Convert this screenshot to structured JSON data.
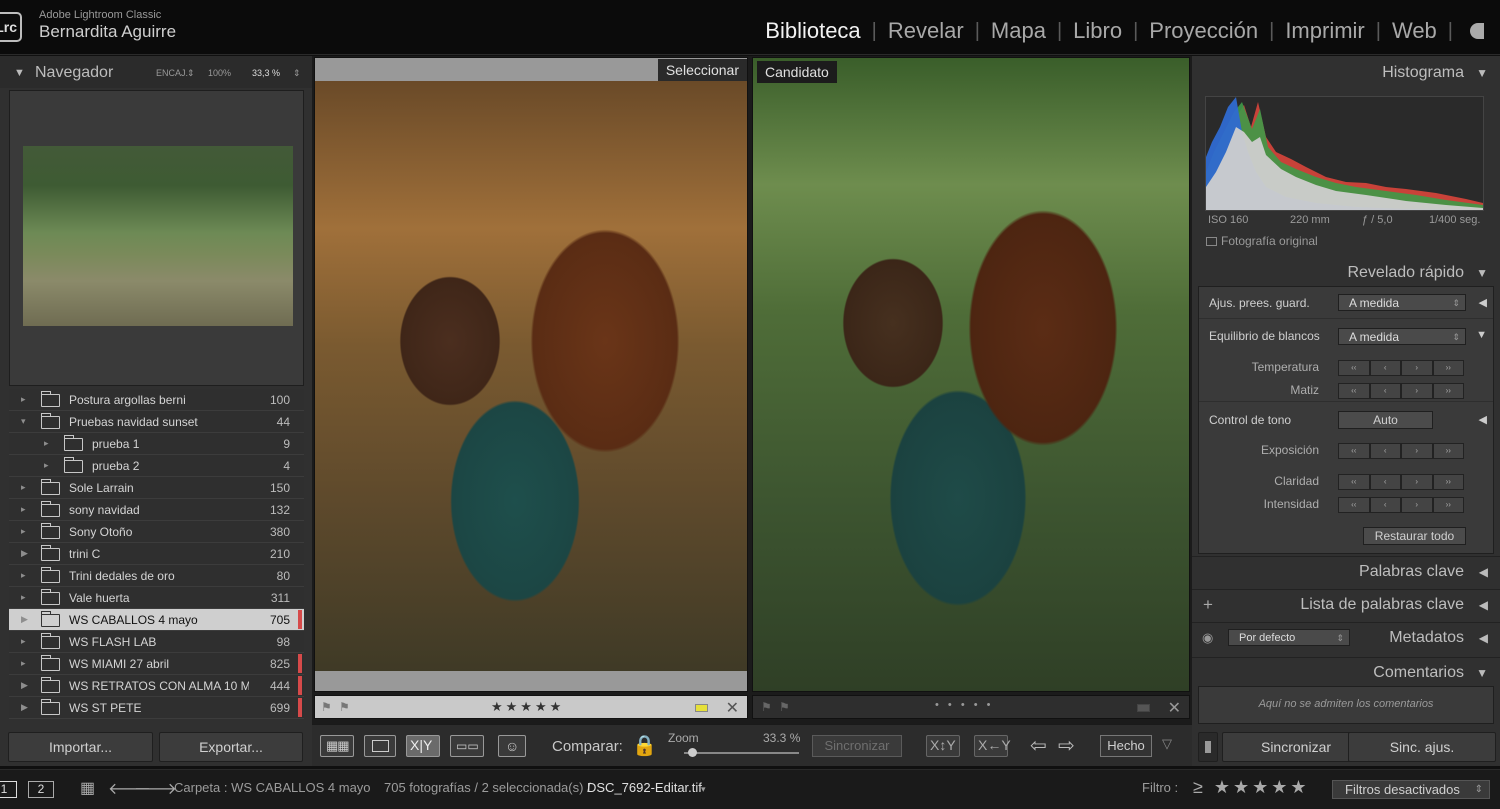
{
  "app": {
    "logo": "Lrc",
    "name": "Adobe Lightroom Classic",
    "user": "Bernardita Aguirre"
  },
  "modules": [
    "Biblioteca",
    "Revelar",
    "Mapa",
    "Libro",
    "Proyección",
    "Imprimir",
    "Web"
  ],
  "active_module": "Biblioteca",
  "navigator": {
    "title": "Navegador",
    "fit": "ENCAJ.",
    "fit_arrows": "⇕",
    "z100": "100%",
    "z33": "33,3 %",
    "z_arrows": "⇕"
  },
  "folders": [
    {
      "name": "Postura argollas berni",
      "count": "100",
      "indent": 0,
      "expand": "▸",
      "mark": false,
      "selected": false
    },
    {
      "name": "Pruebas navidad sunset",
      "count": "44",
      "indent": 0,
      "expand": "▾",
      "mark": false,
      "selected": false
    },
    {
      "name": "prueba 1",
      "count": "9",
      "indent": 1,
      "expand": "▸",
      "mark": false,
      "selected": false
    },
    {
      "name": "prueba 2",
      "count": "4",
      "indent": 1,
      "expand": "▸",
      "mark": false,
      "selected": false
    },
    {
      "name": "Sole Larrain",
      "count": "150",
      "indent": 0,
      "expand": "▸",
      "mark": false,
      "selected": false
    },
    {
      "name": "sony navidad",
      "count": "132",
      "indent": 0,
      "expand": "▸",
      "mark": false,
      "selected": false
    },
    {
      "name": "Sony Otoño",
      "count": "380",
      "indent": 0,
      "expand": "▸",
      "mark": false,
      "selected": false
    },
    {
      "name": "trini C",
      "count": "210",
      "indent": 0,
      "expand": "▶",
      "mark": false,
      "selected": false
    },
    {
      "name": "Trini dedales de oro",
      "count": "80",
      "indent": 0,
      "expand": "▸",
      "mark": false,
      "selected": false
    },
    {
      "name": "Vale huerta",
      "count": "311",
      "indent": 0,
      "expand": "▸",
      "mark": false,
      "selected": false
    },
    {
      "name": "WS CABALLOS 4 mayo",
      "count": "705",
      "indent": 0,
      "expand": "▶",
      "mark": true,
      "selected": true
    },
    {
      "name": "WS FLASH LAB",
      "count": "98",
      "indent": 0,
      "expand": "▸",
      "mark": false,
      "selected": false
    },
    {
      "name": "WS MIAMI 27 abril",
      "count": "825",
      "indent": 0,
      "expand": "▸",
      "mark": true,
      "selected": false
    },
    {
      "name": "WS RETRATOS CON ALMA 10 M...",
      "count": "444",
      "indent": 0,
      "expand": "▶",
      "mark": true,
      "selected": false
    },
    {
      "name": "WS ST PETE",
      "count": "699",
      "indent": 0,
      "expand": "▶",
      "mark": true,
      "selected": false
    }
  ],
  "left_buttons": {
    "import": "Importar...",
    "export": "Exportar..."
  },
  "compare": {
    "select_label": "Seleccionar",
    "candidate_label": "Candidato",
    "select_stars": "★★★★★",
    "candidate_stars": "• • • • •",
    "label_color": "#e6e03a"
  },
  "toolbar": {
    "compare_label": "Comparar:",
    "zoom_label": "Zoom",
    "zoom_value": "33.3 %",
    "zoom_level": 0.05,
    "sync": "Sincronizar",
    "done": "Hecho"
  },
  "right": {
    "histogram_title": "Histograma",
    "iso": "ISO 160",
    "focal": "220 mm",
    "aperture": "ƒ / 5,0",
    "shutter": "1/400 seg.",
    "original_photo": "Fotografía original",
    "quick_develop": "Revelado rápido",
    "preset_label": "Ajus. prees. guard.",
    "preset_value": "A medida",
    "wb_label": "Equilibrio de blancos",
    "wb_value": "A medida",
    "temp_label": "Temperatura",
    "tint_label": "Matiz",
    "tone_label": "Control de tono",
    "auto": "Auto",
    "exposure_label": "Exposición",
    "clarity_label": "Claridad",
    "vibrance_label": "Intensidad",
    "reset_all": "Restaurar todo",
    "keywording": "Palabras clave",
    "keyword_list": "Lista de palabras clave",
    "metadata_preset": "Por defecto",
    "metadata": "Metadatos",
    "comments": "Comentarios",
    "comments_note": "Aquí no se admiten los comentarios",
    "sync": "Sincronizar",
    "sync_settings": "Sinc. ajus."
  },
  "bottom": {
    "page1": "1",
    "page2": "2",
    "path": "Carpeta : WS CABALLOS 4 mayo",
    "count": "705 fotografías / 2 seleccionada(s) /",
    "filename": "DSC_7692-Editar.tif",
    "filter_label": "Filtro :",
    "filter_stars": "≥ ★★★★★",
    "filter_value": "Filtros desactivados"
  }
}
